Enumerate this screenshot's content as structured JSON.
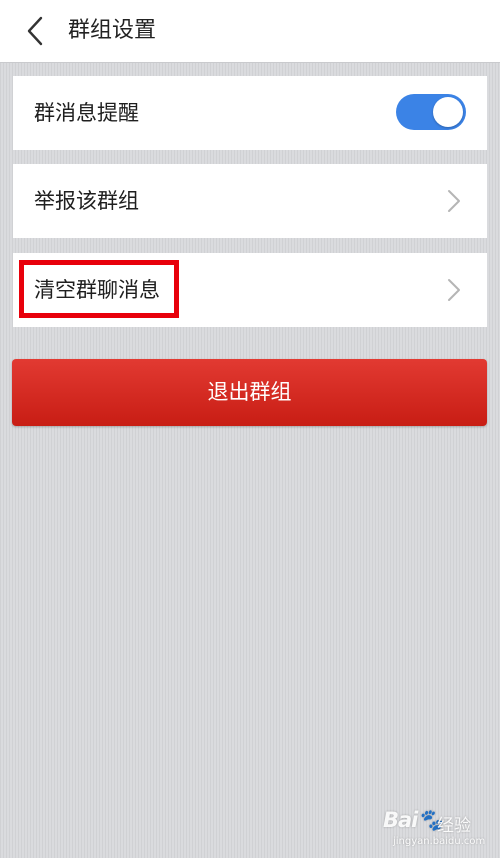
{
  "header": {
    "back_icon": "chevron-left-icon",
    "title": "群组设置"
  },
  "settings": {
    "group_notification": {
      "label": "群消息提醒",
      "enabled": true,
      "toggle_color": "#3b83e6"
    },
    "report_group": {
      "label": "举报该群组",
      "icon": "chevron-right-icon"
    },
    "clear_messages": {
      "label": "清空群聊消息",
      "icon": "chevron-right-icon",
      "highlighted": true,
      "highlight_color": "#e8000b"
    }
  },
  "exit_button": {
    "label": "退出群组",
    "color": "#d42a21"
  },
  "watermark": {
    "logo": "Bai🐾",
    "name": "经验",
    "url": "jingyan.baidu.com"
  }
}
